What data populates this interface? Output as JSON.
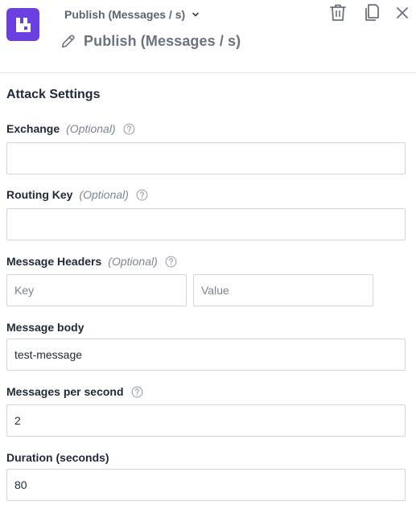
{
  "header": {
    "type_selector_label": "Publish (Messages / s)",
    "title": "Publish (Messages / s)",
    "icons": {
      "logo": "rabbitmq-logo",
      "delete": "trash-icon",
      "duplicate": "copy-icon",
      "close": "close-icon",
      "edit": "pencil-icon",
      "dropdown": "chevron-down-icon"
    }
  },
  "section": {
    "title": "Attack Settings"
  },
  "fields": {
    "exchange": {
      "label": "Exchange",
      "optional": "(Optional)",
      "value": ""
    },
    "routing_key": {
      "label": "Routing Key",
      "optional": "(Optional)",
      "value": ""
    },
    "headers": {
      "label": "Message Headers",
      "optional": "(Optional)",
      "key_placeholder": "Key",
      "value_placeholder": "Value"
    },
    "body": {
      "label": "Message body",
      "value": "test-message"
    },
    "rate": {
      "label": "Messages per second",
      "value": "2"
    },
    "duration": {
      "label": "Duration (seconds)",
      "value": "80"
    }
  },
  "colors": {
    "brand": "#6c3fe0",
    "border": "#d1d5db",
    "muted": "#7c8594"
  }
}
